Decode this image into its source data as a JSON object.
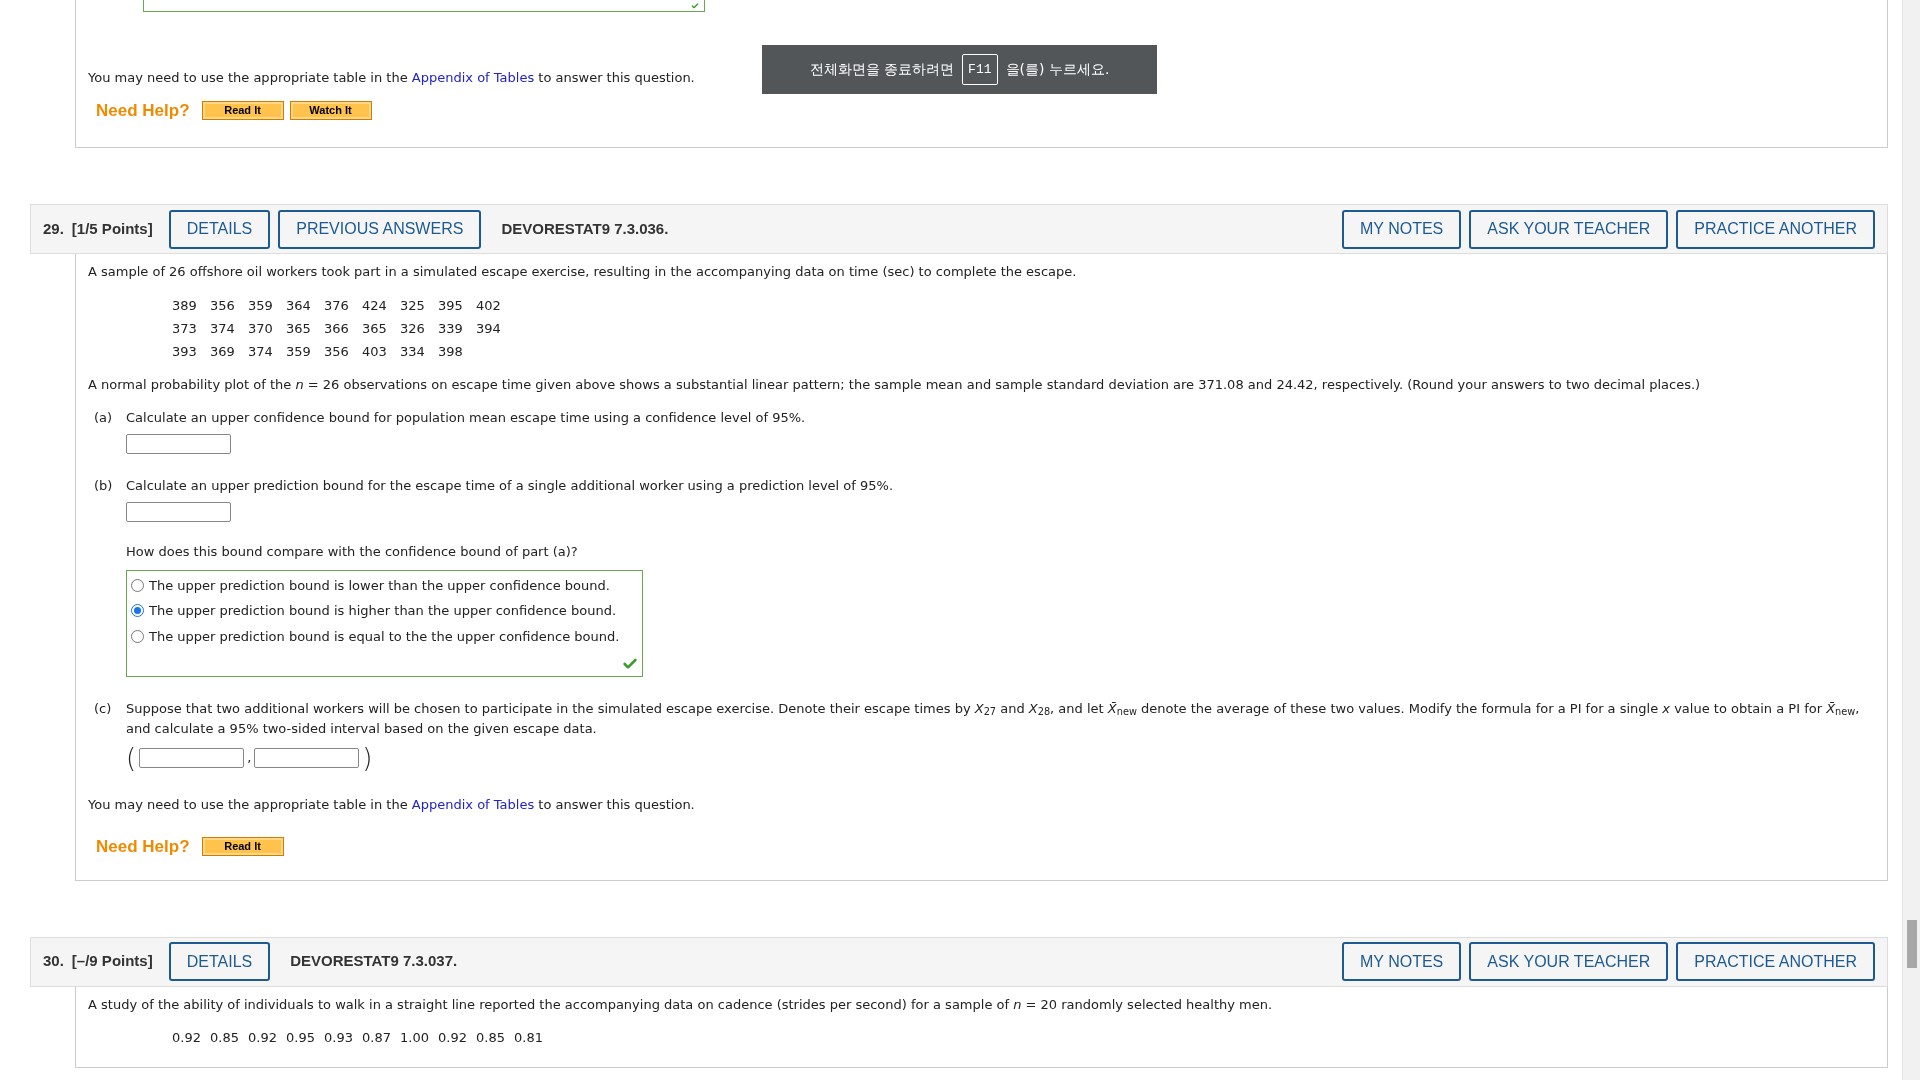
{
  "prev_question": {
    "answer_box": {
      "correct": true
    },
    "appendix_note": {
      "before": "You may need to use the appropriate table in the ",
      "link": "Appendix of Tables",
      "after": " to answer this question."
    },
    "need_help": "Need Help?",
    "help_buttons": [
      "Read It",
      "Watch It"
    ]
  },
  "fullscreen_toast": {
    "before": "전체화면을 종료하려면",
    "key": "F11",
    "after": "을(를) 누르세요."
  },
  "questions": [
    {
      "number": "29.",
      "points": "[1/5 Points]",
      "left_buttons": [
        "DETAILS",
        "PREVIOUS ANSWERS"
      ],
      "code": "DEVORESTAT9 7.3.036.",
      "right_buttons": [
        "MY NOTES",
        "ASK YOUR TEACHER",
        "PRACTICE ANOTHER"
      ],
      "intro": "A sample of 26 offshore oil workers took part in a simulated escape exercise, resulting in the accompanying data on time (sec) to complete the escape.",
      "data_rows": [
        [
          "389",
          "356",
          "359",
          "364",
          "376",
          "424",
          "325",
          "395",
          "402"
        ],
        [
          "373",
          "374",
          "370",
          "365",
          "366",
          "365",
          "326",
          "339",
          "394"
        ],
        [
          "393",
          "369",
          "374",
          "359",
          "356",
          "403",
          "334",
          "398"
        ]
      ],
      "statement": "A normal probability plot of the *n* = 26 observations on escape time given above shows a substantial linear pattern; the sample mean and sample standard deviation are 371.08 and 24.42, respectively. (Round your answers to two decimal places.)",
      "parts": [
        {
          "label": "(a)",
          "text": "Calculate an upper confidence bound for population mean escape time using a confidence level of 95%.",
          "kind": "input"
        },
        {
          "label": "(b)",
          "text": "Calculate an upper prediction bound for the escape time of a single additional worker using a prediction level of 95%.",
          "kind": "input",
          "followup": {
            "question": "How does this bound compare with the confidence bound of part (a)?",
            "correct": true,
            "options": [
              {
                "label": "The upper prediction bound is lower than the upper confidence bound.",
                "selected": false
              },
              {
                "label": "The upper prediction bound is higher than the upper confidence bound.",
                "selected": true
              },
              {
                "label": "The upper prediction bound is equal to the the upper confidence bound.",
                "selected": false
              }
            ]
          }
        },
        {
          "label": "(c)",
          "text": "Suppose that two additional workers will be chosen to participate in the simulated escape exercise. Denote their escape times by *X*$_{27}$ and *X*$_{28}$, and let *X̄*$_{new}$ denote the average of these two values. Modify the formula for a PI for a single *x* value to obtain a PI for *X̄*$_{new}$, and calculate a 95% two-sided interval based on the given escape data.",
          "kind": "interval",
          "interval": {
            "open": "(",
            "separator": ",",
            "close": ")"
          }
        }
      ],
      "appendix_note": {
        "before": "You may need to use the appropriate table in the ",
        "link": "Appendix of Tables",
        "after": " to answer this question."
      },
      "need_help": "Need Help?",
      "help_buttons": [
        "Read It"
      ]
    },
    {
      "number": "30.",
      "points": "[–/9 Points]",
      "left_buttons": [
        "DETAILS"
      ],
      "code": "DEVORESTAT9 7.3.037.",
      "right_buttons": [
        "MY NOTES",
        "ASK YOUR TEACHER",
        "PRACTICE ANOTHER"
      ],
      "intro": "A study of the ability of individuals to walk in a straight line reported the accompanying data on cadence (strides per second) for a sample of *n* = 20 randomly selected healthy men.",
      "data_rows": [
        [
          "0.92",
          "0.85",
          "0.92",
          "0.95",
          "0.93",
          "0.87",
          "1.00",
          "0.92",
          "0.85",
          "0.81"
        ]
      ]
    }
  ]
}
